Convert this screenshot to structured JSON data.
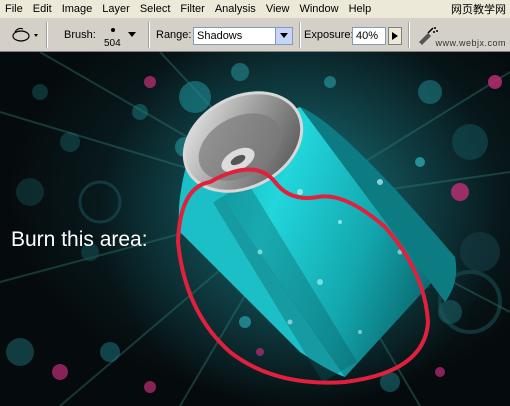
{
  "menu": [
    "File",
    "Edit",
    "Image",
    "Layer",
    "Select",
    "Filter",
    "Analysis",
    "View",
    "Window",
    "Help"
  ],
  "watermark_cn": "网页教学网",
  "watermark_url": "www.webjx.com",
  "options": {
    "tool_icon": "burn-tool-icon",
    "brush_label": "Brush:",
    "brush_size": "504",
    "range_label": "Range:",
    "range_value": "Shadows",
    "exposure_label": "Exposure:",
    "exposure_value": "40%",
    "airbrush_icon": "airbrush-icon"
  },
  "canvas": {
    "annotation": "Burn this area:",
    "circle_color": "#e0203c",
    "can_color": "#1fd3d8"
  }
}
